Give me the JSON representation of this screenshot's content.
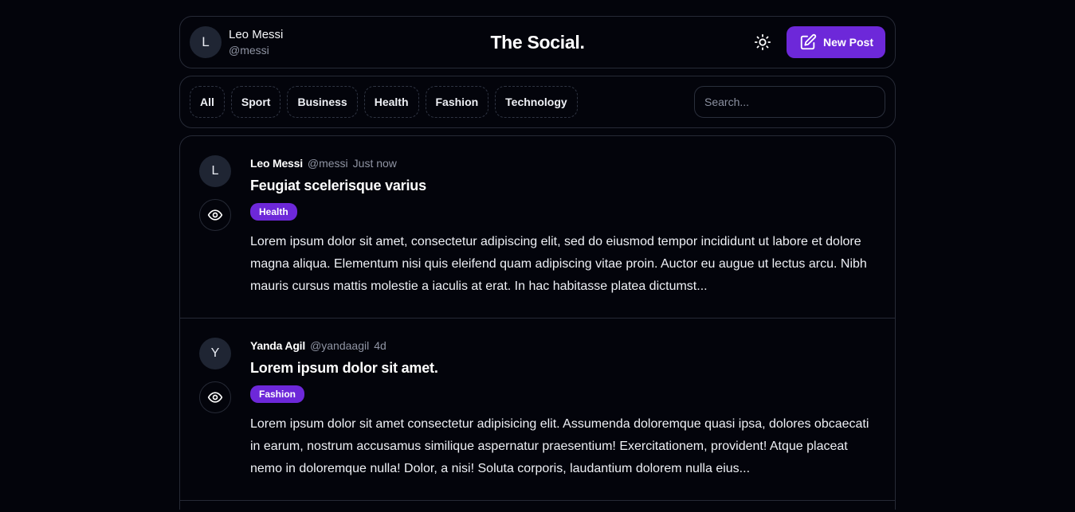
{
  "header": {
    "user": {
      "initial": "L",
      "name": "Leo Messi",
      "handle": "@messi"
    },
    "brand": "The Social.",
    "theme_icon": "sun-icon",
    "new_post_label": "New Post",
    "new_post_icon": "edit-icon"
  },
  "filters": {
    "categories": [
      "All",
      "Sport",
      "Business",
      "Health",
      "Fashion",
      "Technology"
    ],
    "search_placeholder": "Search..."
  },
  "posts": [
    {
      "initial": "L",
      "author": "Leo Messi",
      "handle": "@messi",
      "time": "Just now",
      "title": "Feugiat scelerisque varius",
      "tag": "Health",
      "excerpt": "Lorem ipsum dolor sit amet, consectetur adipiscing elit, sed do eiusmod tempor incididunt ut labore et dolore magna aliqua. Elementum nisi quis eleifend quam adipiscing vitae proin. Auctor eu augue ut lectus arcu. Nibh mauris cursus mattis molestie a iaculis at erat. In hac habitasse platea dictumst..."
    },
    {
      "initial": "Y",
      "author": "Yanda Agil",
      "handle": "@yandaagil",
      "time": "4d",
      "title": "Lorem ipsum dolor sit amet.",
      "tag": "Fashion",
      "excerpt": "Lorem ipsum dolor sit amet consectetur adipisicing elit. Assumenda doloremque quasi ipsa, dolores obcaecati in earum, nostrum accusamus similique aspernatur praesentium! Exercitationem, provident! Atque placeat nemo in doloremque nulla! Dolor, a nisi! Soluta corporis, laudantium dolorem nulla eius..."
    }
  ],
  "colors": {
    "background": "#03040b",
    "accent": "#6d28d9",
    "border": "#262a36",
    "muted_text": "#8f94a3"
  }
}
